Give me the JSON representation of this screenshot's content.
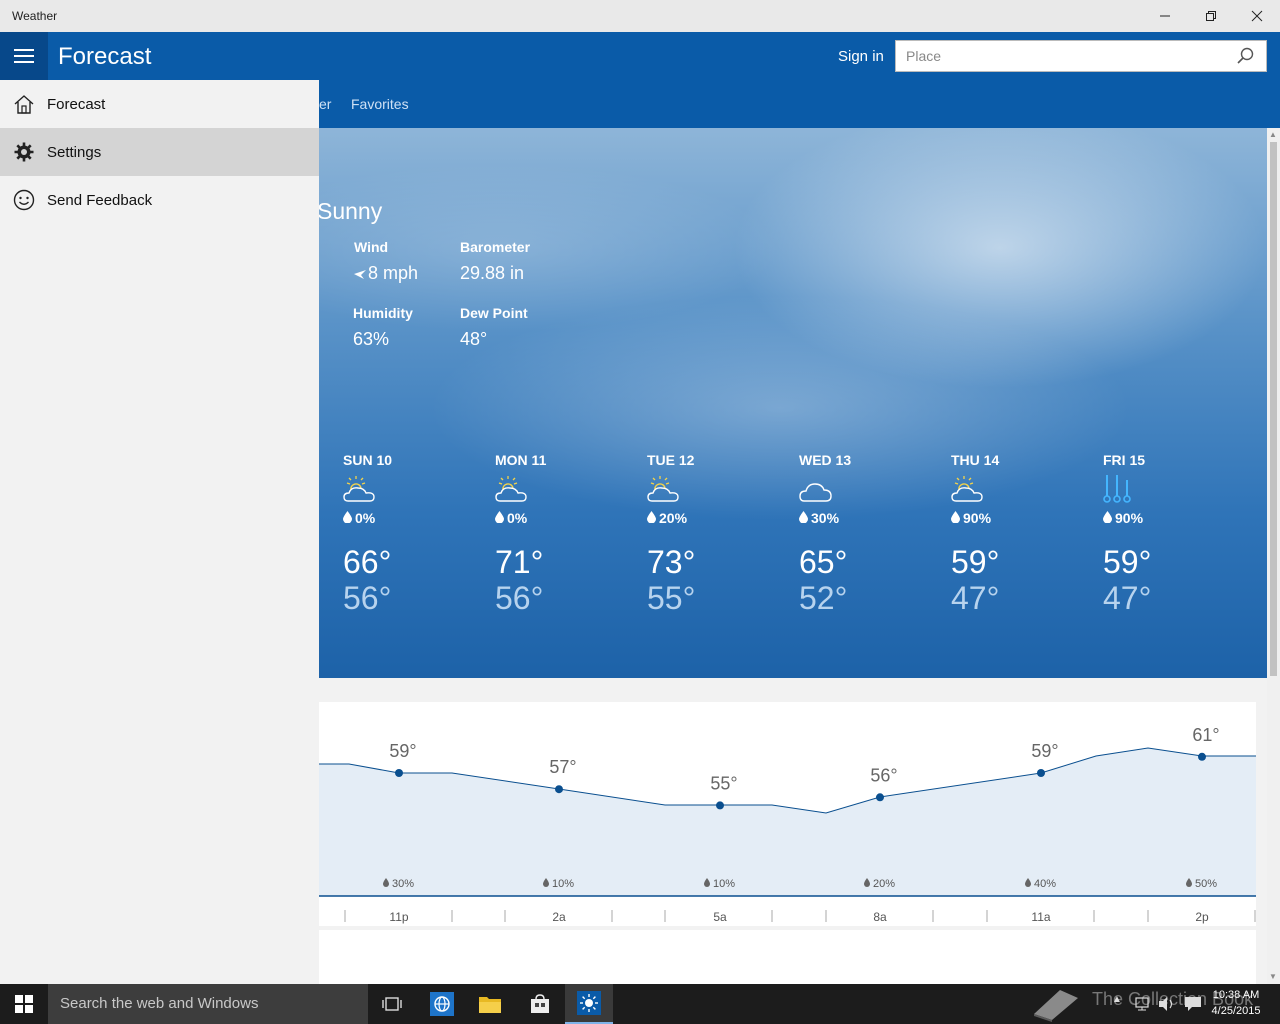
{
  "window": {
    "title": "Weather"
  },
  "header": {
    "title": "Forecast",
    "sign_in": "Sign in",
    "search_placeholder": "Place",
    "tabs": [
      {
        "label": "er"
      },
      {
        "label": "Favorites"
      }
    ]
  },
  "nav_pane": {
    "items": [
      {
        "label": "Forecast",
        "icon": "home-icon",
        "selected": false
      },
      {
        "label": "Settings",
        "icon": "gear-icon",
        "selected": true
      },
      {
        "label": "Send Feedback",
        "icon": "smiley-icon",
        "selected": false
      }
    ]
  },
  "current": {
    "condition": "Sunny",
    "wind_label": "Wind",
    "wind_value": "8 mph",
    "barometer_label": "Barometer",
    "barometer_value": "29.88 in",
    "humidity_label": "Humidity",
    "humidity_value": "63%",
    "dewpoint_label": "Dew Point",
    "dewpoint_value": "48°"
  },
  "daily": [
    {
      "day": "SUN 10",
      "icon": "partly-sunny-icon",
      "precip": "0%",
      "high": "66°",
      "low": "56°"
    },
    {
      "day": "MON 11",
      "icon": "partly-sunny-icon",
      "precip": "0%",
      "high": "71°",
      "low": "56°"
    },
    {
      "day": "TUE 12",
      "icon": "partly-sunny-icon",
      "precip": "20%",
      "high": "73°",
      "low": "55°"
    },
    {
      "day": "WED 13",
      "icon": "cloudy-icon",
      "precip": "30%",
      "high": "65°",
      "low": "52°"
    },
    {
      "day": "THU 14",
      "icon": "partly-sunny-icon",
      "precip": "90%",
      "high": "59°",
      "low": "47°"
    },
    {
      "day": "FRI 15",
      "icon": "rain-icon",
      "precip": "90%",
      "high": "59°",
      "low": "47°"
    }
  ],
  "hourly": {
    "labels": [
      "11p",
      "2a",
      "5a",
      "8a",
      "11a",
      "2p"
    ],
    "temp_labels": [
      "59°",
      "57°",
      "55°",
      "56°",
      "59°",
      "61°"
    ],
    "temps": [
      59,
      57,
      55,
      56,
      59,
      61
    ],
    "precip": [
      "30%",
      "10%",
      "10%",
      "20%",
      "40%",
      "50%"
    ]
  },
  "taskbar": {
    "search_text": "Search the web and Windows",
    "watermark": "The Collection Book",
    "time": "10:38 AM",
    "date": "4/25/2015"
  },
  "colors": {
    "accent": "#0a5ba8",
    "accent_dark": "#07488a",
    "chart_line": "#0a4f8f",
    "chart_fill": "#e4edf6"
  }
}
